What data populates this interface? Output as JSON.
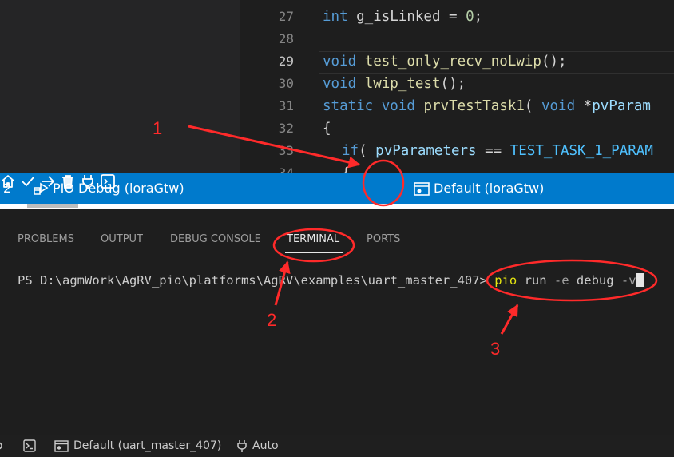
{
  "editor": {
    "lines": [
      {
        "n": "27",
        "active": false
      },
      {
        "n": "28",
        "active": false
      },
      {
        "n": "29",
        "active": true
      },
      {
        "n": "30",
        "active": false
      },
      {
        "n": "31",
        "active": false
      },
      {
        "n": "32",
        "active": false
      },
      {
        "n": "33",
        "active": false
      },
      {
        "n": "34",
        "active": false
      }
    ],
    "code": {
      "l27": {
        "kw": "int",
        "rest": " g_isLinked = ",
        "num": "0",
        "end": ";"
      },
      "l29": {
        "kw": "void",
        "fn": "test_only_recv_noLwip",
        "end": "();"
      },
      "l30": {
        "kw": "void",
        "fn": "lwip_test",
        "end": "();"
      },
      "l31": {
        "kw1": "static",
        "kw2": "void",
        "fn": "prvTestTask1",
        "open": "( ",
        "kw3": "void",
        "ptr": " *",
        "var": "pvParam"
      },
      "l32": {
        "text": "{"
      },
      "l33": {
        "kw": "if",
        "open": "( ",
        "var": "pvParameters",
        "op": " == ",
        "mac": "TEST_TASK_1_PARAM"
      },
      "l34": {
        "text": "{"
      }
    }
  },
  "statusbar": {
    "problems_count": "2",
    "debug_label": "PIO Debug (loraGtw)",
    "env_label": "Default (loraGtw)"
  },
  "panel": {
    "tabs": [
      "PROBLEMS",
      "OUTPUT",
      "DEBUG CONSOLE",
      "TERMINAL",
      "PORTS"
    ],
    "active_tab": "TERMINAL",
    "terminal": {
      "prompt": "PS D:\\agmWork\\AgRV_pio\\platforms\\AgRV\\examples\\uart_master_407> ",
      "cmd": "pio",
      "args": " run ",
      "flag1": "-e",
      "arg2": " debug ",
      "flag2": "-v"
    }
  },
  "bottombar": {
    "env_label": "Default (uart_master_407)",
    "port_label": "Auto"
  },
  "annotations": {
    "label1": "1",
    "label2": "2",
    "label3": "3",
    "color": "#ff2a2a"
  }
}
